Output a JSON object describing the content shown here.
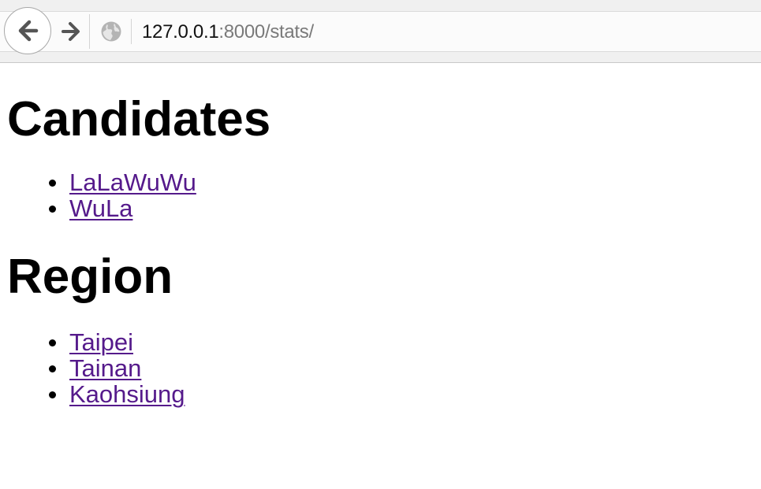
{
  "browser": {
    "url_host": "127.0.0.1",
    "url_rest": ":8000/stats/",
    "colors": {
      "toolbar": "#f0f0f0",
      "visited_link": "#551a8b"
    }
  },
  "page": {
    "sections": [
      {
        "heading": "Candidates",
        "items": [
          {
            "label": "LaLaWuWu"
          },
          {
            "label": "WuLa"
          }
        ]
      },
      {
        "heading": "Region",
        "items": [
          {
            "label": "Taipei"
          },
          {
            "label": "Tainan"
          },
          {
            "label": "Kaohsiung"
          }
        ]
      }
    ]
  }
}
